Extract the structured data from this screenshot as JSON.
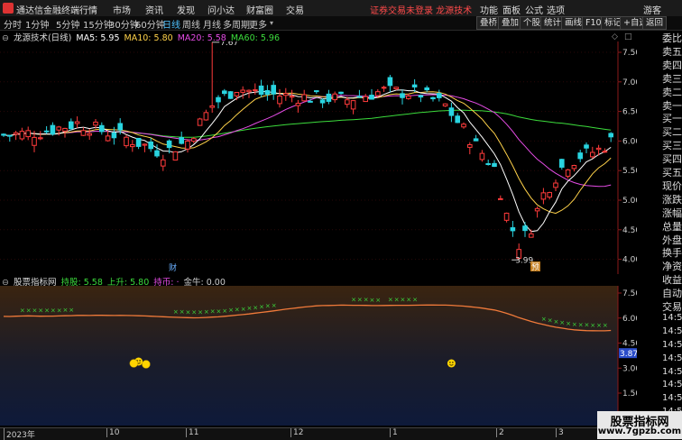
{
  "app": {
    "name": "通达信金融终端",
    "menus": [
      "行情",
      "市场",
      "资讯",
      "发现",
      "问小达",
      "财富圈",
      "交易"
    ],
    "notice": "证券交易未登录  龙源技术",
    "right_menus": [
      "功能",
      "面板",
      "公式",
      "选项",
      "游客"
    ]
  },
  "toolbar": {
    "periods": [
      "分时",
      "1分钟",
      "5分钟",
      "15分钟",
      "30分钟",
      "60分钟",
      "日线",
      "周线",
      "月线",
      "多周期",
      "更多"
    ],
    "active_period": "日线",
    "tools": [
      "叠桥",
      "叠加",
      "个股",
      "统计",
      "画线",
      "F10",
      "标记",
      "+自选",
      "返回"
    ]
  },
  "ma_legend": {
    "title": "龙源技术(日线)",
    "items": [
      {
        "label": "MA5: 5.95",
        "color": "#ffffff"
      },
      {
        "label": "MA10: 5.80",
        "color": "#ffd24a"
      },
      {
        "label": "MA20: 5.58",
        "color": "#e64ce6"
      },
      {
        "label": "MA60: 5.96",
        "color": "#3cdc3c"
      }
    ]
  },
  "price_axis": [
    "7.50",
    "7.00",
    "6.50",
    "6.00",
    "5.50",
    "5.00",
    "4.50",
    "4.00"
  ],
  "annotations": {
    "high": "7.67",
    "low": "3.99",
    "marker_cai": "财",
    "marker_yi": "预"
  },
  "indicator": {
    "title": "股票指标网",
    "items": [
      {
        "label": "持股: 5.58",
        "color": "#3cdc3c"
      },
      {
        "label": "上升: 5.80",
        "color": "#3cdc3c"
      },
      {
        "label": "持币: ·",
        "color": "#e64ce6"
      },
      {
        "label": "金牛: 0.00",
        "color": "#cccccc"
      }
    ],
    "axis": [
      "7.50",
      "6.00",
      "4.50",
      "3.00",
      "1.50"
    ],
    "current_value": "3.87"
  },
  "right_panel": [
    "委比",
    "卖五",
    "卖四",
    "卖三",
    "卖二",
    "卖一",
    "买一",
    "买二",
    "买三",
    "买四",
    "买五",
    "现价",
    "涨跌",
    "涨幅",
    "总量",
    "外盘",
    "换手",
    "净资",
    "收益",
    "自动",
    "交易",
    "14:55",
    "14:55",
    "14:55",
    "14:55",
    "14:55",
    "14:55",
    "14:55",
    "14:55"
  ],
  "date_axis": [
    "2023年",
    "10",
    "11",
    "12",
    "1",
    "2",
    "3"
  ],
  "watermark": {
    "title": "股票指标网",
    "url": "www.7gpzb.com"
  },
  "colors": {
    "up": "#ff3b3b",
    "down": "#29d4e0",
    "bg": "#000000"
  }
}
